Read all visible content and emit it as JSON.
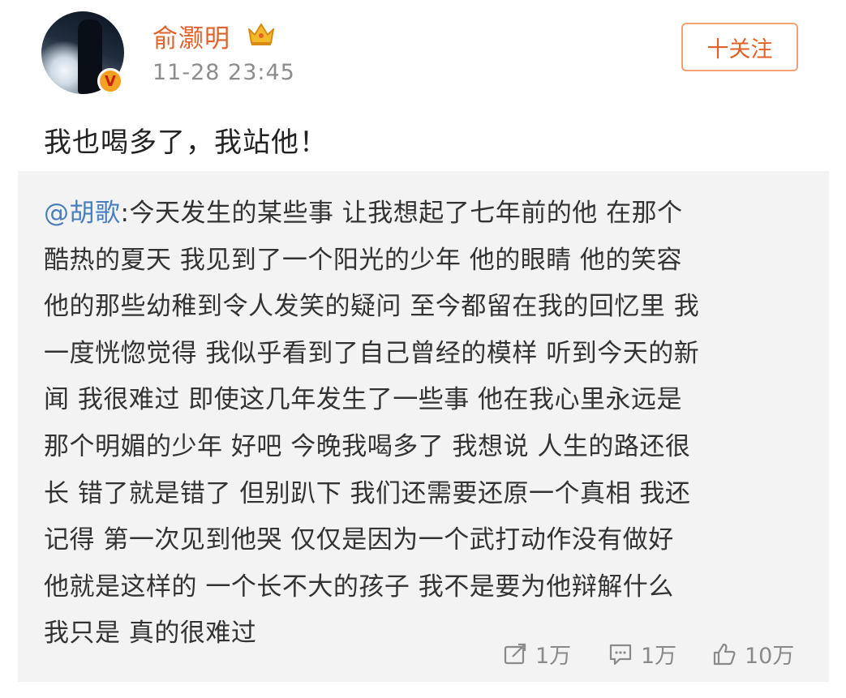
{
  "user": {
    "name": "俞灏明",
    "timestamp": "11-28 23:45",
    "verified_badge": "V"
  },
  "follow_button": {
    "label": "十关注"
  },
  "post": {
    "text": "我也喝多了，我站他！"
  },
  "repost": {
    "mention": "@胡歌",
    "lines": [
      ":今天发生的某些事 让我想起了七年前的他 在那个",
      "酷热的夏天 我见到了一个阳光的少年 他的眼睛 他的笑容",
      "他的那些幼稚到令人发笑的疑问 至今都留在我的回忆里 我",
      "一度恍惚觉得 我似乎看到了自己曾经的模样 听到今天的新",
      "闻 我很难过 即使这几年发生了一些事 他在我心里永远是",
      "那个明媚的少年 好吧 今晚我喝多了 我想说 人生的路还很",
      "长 错了就是错了 但别趴下 我们还需要还原一个真相 我还",
      "记得 第一次见到他哭 仅仅是因为一个武打动作没有做好",
      "他就是这样的 一个长不大的孩子 我不是要为他辩解什么",
      "我只是 真的很难过"
    ]
  },
  "actions": {
    "repost_count": "1万",
    "comment_count": "1万",
    "like_count": "10万"
  },
  "colors": {
    "accent": "#e0622a",
    "mention": "#4a7fbf",
    "repost_bg": "#f3f3f3"
  },
  "icons": [
    "avatar",
    "verified-badge-icon",
    "crown-icon",
    "repost-icon",
    "comment-icon",
    "like-icon"
  ]
}
